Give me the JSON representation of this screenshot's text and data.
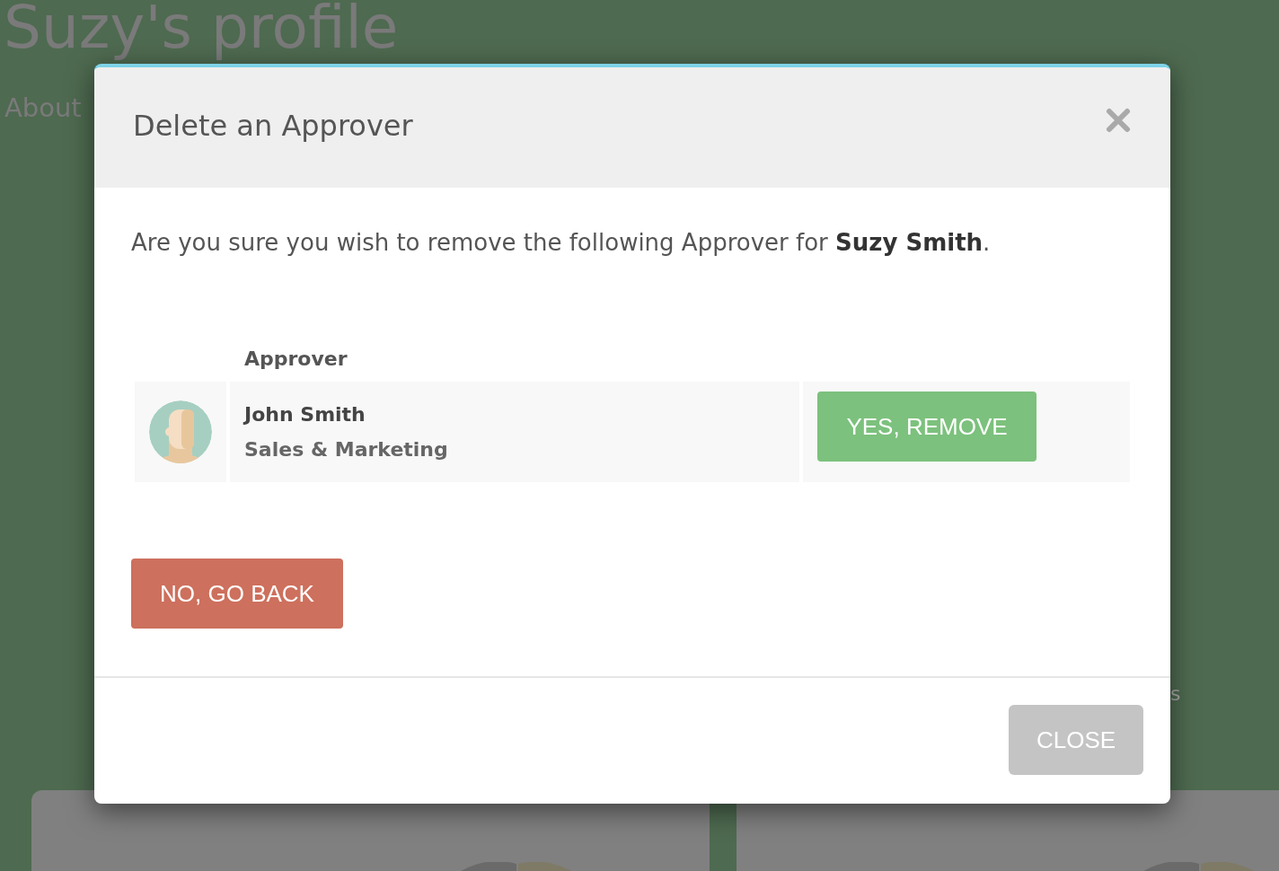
{
  "background": {
    "title": "Suzy's profile",
    "tab": "About",
    "fragment": "s"
  },
  "dialog": {
    "title": "Delete an Approver",
    "message": "Are you sure you wish to remove the following Approver for **Suzy Smith**.",
    "columns": [
      "Approver"
    ],
    "approvers": [
      {
        "name": "John Smith",
        "department": "Sales & Marketing",
        "action": "YES, REMOVE"
      }
    ],
    "back_button": "NO, GO BACK",
    "footer_button": "CLOSE"
  }
}
